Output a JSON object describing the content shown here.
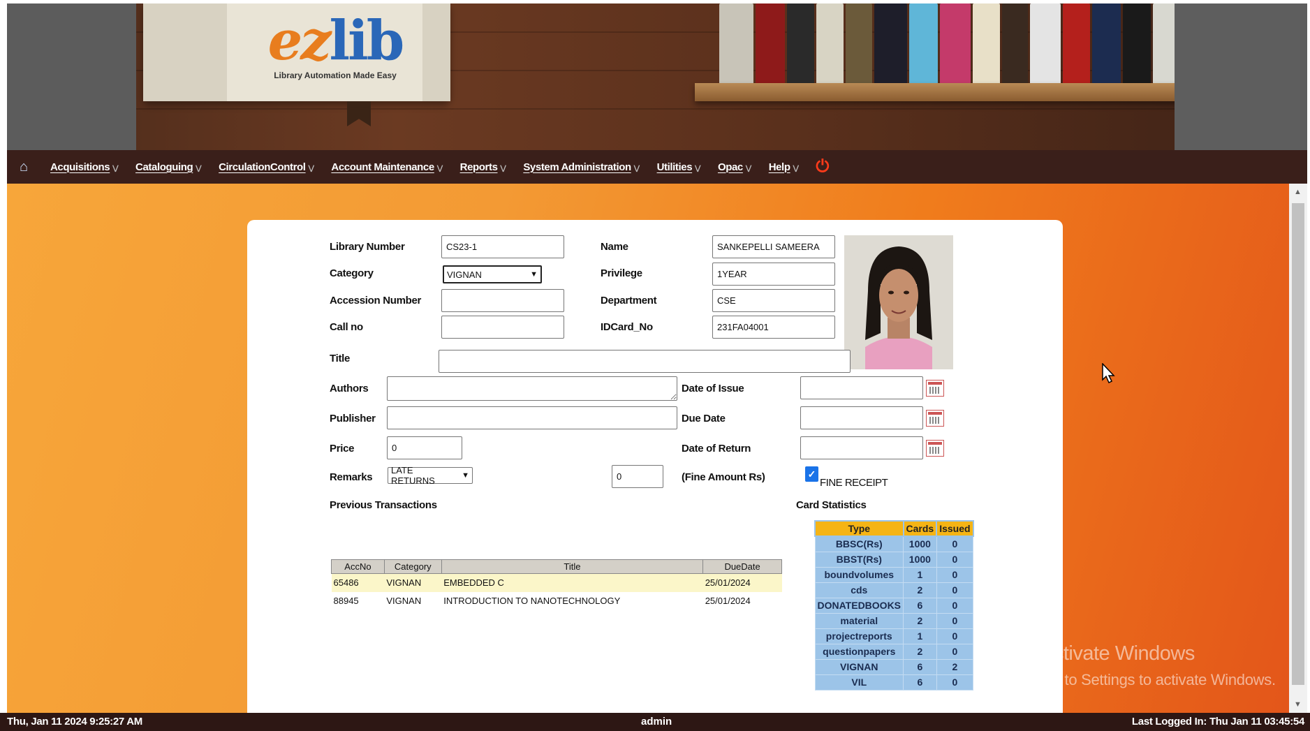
{
  "banner": {
    "logo_text_ez": "ez",
    "logo_text_lib": "lib",
    "logo_tagline": "Library Automation Made Easy"
  },
  "menu": {
    "home_icon": "home-icon",
    "items": [
      {
        "label": "Acquisitions"
      },
      {
        "label": "Cataloguing"
      },
      {
        "label": "CirculationControl"
      },
      {
        "label": "Account Maintenance"
      },
      {
        "label": "Reports"
      },
      {
        "label": "System Administration"
      },
      {
        "label": "Utilities"
      },
      {
        "label": "Opac"
      },
      {
        "label": "Help"
      }
    ],
    "power_icon": "power-icon"
  },
  "form": {
    "library_number_label": "Library Number",
    "library_number_value": "CS23-1",
    "name_label": "Name",
    "name_value": "SANKEPELLI SAMEERA",
    "category_label": "Category",
    "category_value": "VIGNAN",
    "privilege_label": "Privilege",
    "privilege_value": "1YEAR",
    "accession_label": "Accession Number",
    "accession_value": "",
    "department_label": "Department",
    "department_value": "CSE",
    "callno_label": "Call no",
    "callno_value": "",
    "idcard_label": "IDCard_No",
    "idcard_value": "231FA04001",
    "title_label": "Title",
    "title_value": "",
    "authors_label": "Authors",
    "authors_value": "",
    "date_issue_label": "Date of Issue",
    "date_issue_value": "",
    "publisher_label": "Publisher",
    "publisher_value": "",
    "due_date_label": "Due Date",
    "due_date_value": "",
    "price_label": "Price",
    "price_value": "0",
    "date_return_label": "Date of Return",
    "date_return_value": "",
    "remarks_label": "Remarks",
    "remarks_value": "LATE RETURNS",
    "fine_value": "0",
    "fine_label": "(Fine Amount Rs)",
    "fine_receipt_label": "FINE RECEIPT",
    "fine_receipt_checked": true,
    "prev_transactions_label": "Previous Transactions",
    "card_stats_label": "Card Statistics"
  },
  "prev_transactions": {
    "headers": [
      "AccNo",
      "Category",
      "Title",
      "DueDate"
    ],
    "rows": [
      {
        "accno": "65486",
        "category": "VIGNAN",
        "title": "EMBEDDED C",
        "duedate": "25/01/2024"
      },
      {
        "accno": "88945",
        "category": "VIGNAN",
        "title": "INTRODUCTION TO NANOTECHNOLOGY",
        "duedate": "25/01/2024"
      }
    ]
  },
  "card_stats": {
    "headers": [
      "Type",
      "Cards",
      "Issued"
    ],
    "rows": [
      {
        "type": "BBSC(Rs)",
        "cards": "1000",
        "issued": "0"
      },
      {
        "type": "BBST(Rs)",
        "cards": "1000",
        "issued": "0"
      },
      {
        "type": "boundvolumes",
        "cards": "1",
        "issued": "0"
      },
      {
        "type": "cds",
        "cards": "2",
        "issued": "0"
      },
      {
        "type": "DONATEDBOOKS",
        "cards": "6",
        "issued": "0"
      },
      {
        "type": "material",
        "cards": "2",
        "issued": "0"
      },
      {
        "type": "projectreports",
        "cards": "1",
        "issued": "0"
      },
      {
        "type": "questionpapers",
        "cards": "2",
        "issued": "0"
      },
      {
        "type": "VIGNAN",
        "cards": "6",
        "issued": "2"
      },
      {
        "type": "VIL",
        "cards": "6",
        "issued": "0"
      }
    ]
  },
  "watermark": {
    "line1": "Activate Windows",
    "line2": "Go to Settings to activate Windows."
  },
  "status": {
    "datetime": "Thu, Jan 11 2024 9:25:27 AM",
    "user": "admin",
    "last_login": "Last Logged In: Thu Jan 11 03:45:54"
  },
  "colors": {
    "menubar": "#3a1f1a",
    "accent_orange": "#f07c1c",
    "card_header": "#f5b415",
    "card_cell": "#9cc4e8"
  }
}
